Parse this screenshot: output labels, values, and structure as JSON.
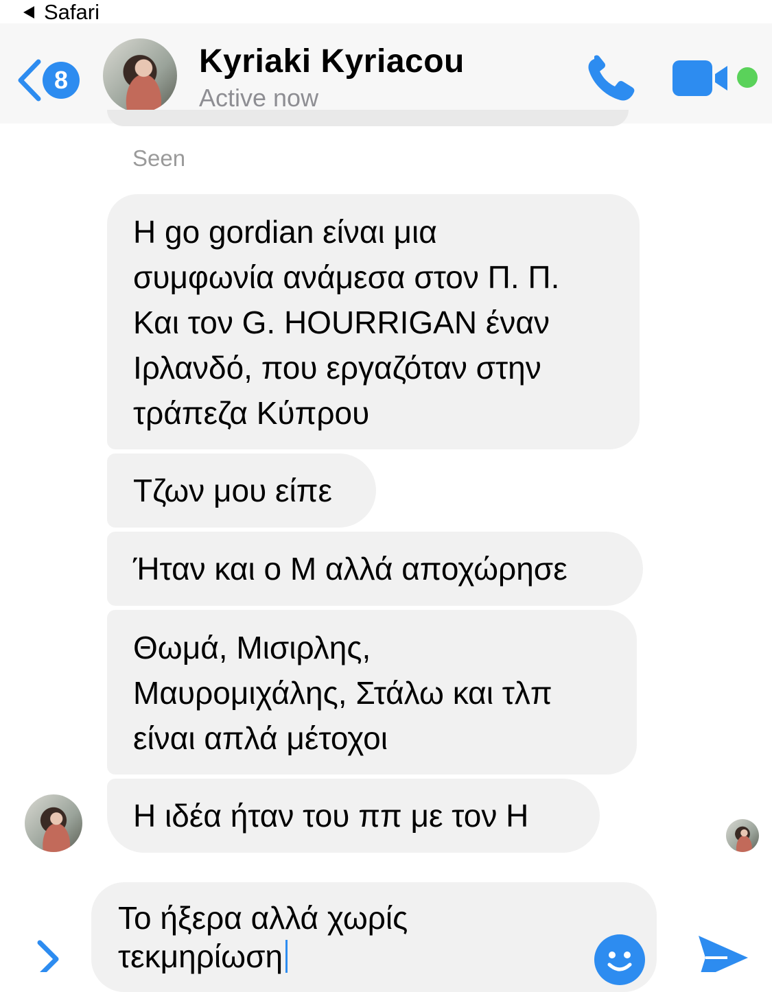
{
  "status_bar": {
    "back_app_label": "Safari"
  },
  "header": {
    "back_badge_count": "8",
    "contact_name": "Kyriaki Kyriacou",
    "contact_status": "Active now",
    "accent_color": "#2d8cf0",
    "online_color": "#5ad25a"
  },
  "conversation": {
    "seen_label": "Seen",
    "messages": [
      {
        "lines": [
          "Η go gordian είναι μια",
          "συμφωνία ανάμεσα στον Π. Π.",
          "Και τον G. HOURRIGAN έναν",
          "Ιρλανδό, που εργαζόταν στην",
          "τράπεζα Κύπρου"
        ]
      },
      {
        "lines": [
          "Τζων μου είπε"
        ]
      },
      {
        "lines": [
          "Ήταν και ο Μ αλλά αποχώρησε"
        ]
      },
      {
        "lines": [
          "Θωμά, Μισιρλης,",
          "Μαυρομιχάλης, Στάλω και τλπ",
          "είναι απλά μέτοχοι"
        ]
      },
      {
        "lines": [
          "Η ιδέα ήταν του ππ με τον Η"
        ]
      }
    ]
  },
  "composer": {
    "input_value": "Το ήξερα αλλά χωρίς\nτεκμηρίωση",
    "icons": [
      "chevron-right-icon",
      "emoji-icon",
      "send-icon"
    ]
  }
}
